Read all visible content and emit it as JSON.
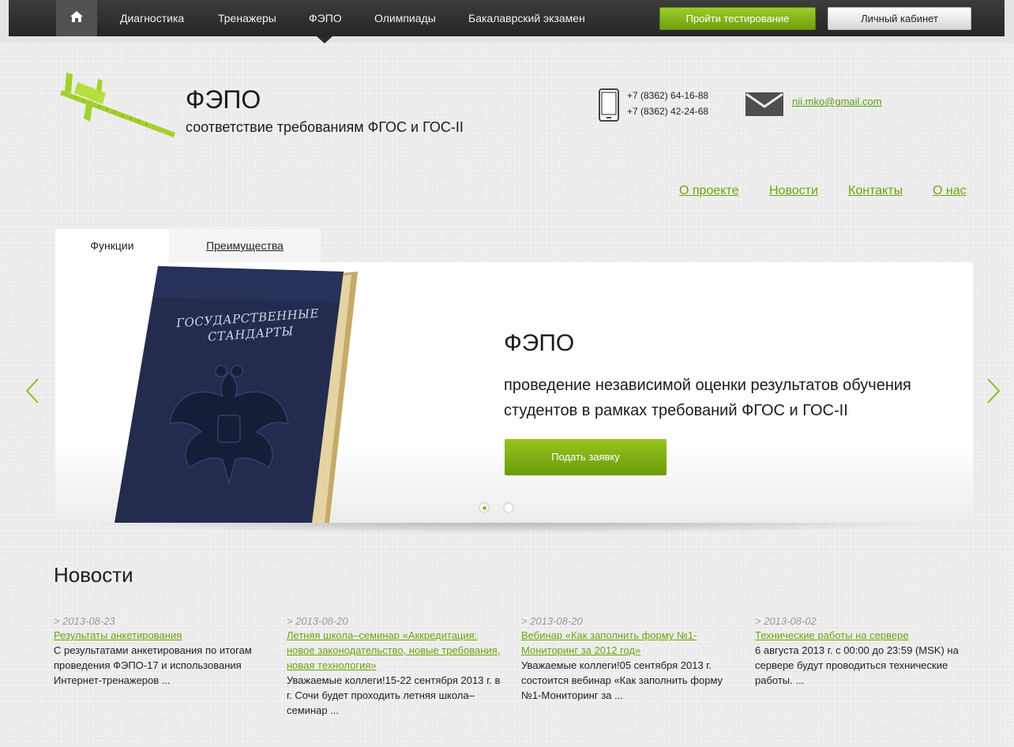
{
  "nav": {
    "items": [
      "Диагностика",
      "Тренажеры",
      "ФЭПО",
      "Олимпиады",
      "Бакалаврский экзамен"
    ],
    "test_button": "Пройти тестирование",
    "cabinet_button": "Личный кабинет"
  },
  "header": {
    "title": "ФЭПО",
    "subtitle": "соответствие требованиям ФГОС и ГОС-II",
    "phone1": "+7 (8362) 64-16-88",
    "phone2": "+7 (8362) 42-24-68",
    "email": "nii.mko@gmail.com"
  },
  "secondary_nav": [
    "О проекте",
    "Новости",
    "Контакты",
    "О нас"
  ],
  "slider": {
    "tabs": [
      "Функции",
      "Преимущества"
    ],
    "book_text_1": "ГОСУДАРСТВЕННЫЕ",
    "book_text_2": "СТАНДАРТЫ",
    "title": "ФЭПО",
    "text": "проведение независимой оценки результатов обучения студентов в рамках требований ФГОС и ГОС-II",
    "button": "Подать заявку",
    "active_dot": 1
  },
  "news": {
    "heading": "Новости",
    "items": [
      {
        "date": "> 2013-08-23",
        "title": "Результаты анкетирования",
        "text": "С результатами анкетирования по итогам проведения ФЭПО-17 и использования Интернет-тренажеров ..."
      },
      {
        "date": "> 2013-08-20",
        "title": "Летняя школа–семинар «Аккредитация: новое законодательство, новые требования, новая технология»",
        "text": "Уважаемые коллеги!15-22 сентября 2013 г. в г. Сочи будет проходить летняя школа–семинар ..."
      },
      {
        "date": "> 2013-08-20",
        "title": "Вебинар «Как заполнить форму №1-Мониторинг за 2012 год»",
        "text": "Уважаемые коллеги!05 сентября 2013 г. состоится вебинар «Как заполнить форму №1-Мониторинг за ..."
      },
      {
        "date": "> 2013-08-02",
        "title": "Технические работы на сервере",
        "text": "6 августа 2013 г. с 00:00 до 23:59 (MSK) на сервере будут проводиться технические работы. ..."
      }
    ]
  },
  "colors": {
    "accent_green": "#6ea30e",
    "topbar": "#2b2b2b",
    "book_blue": "#232c4e"
  }
}
